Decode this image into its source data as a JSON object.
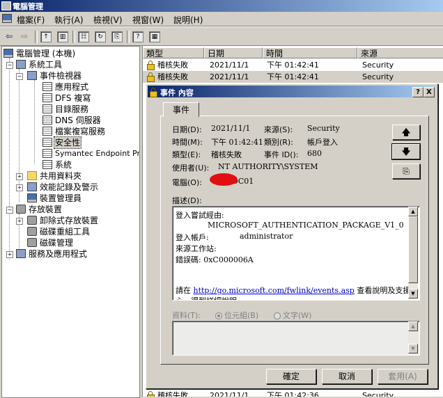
{
  "window": {
    "title": "電腦管理"
  },
  "menu": [
    {
      "label": "檔案(F)"
    },
    {
      "label": "執行(A)"
    },
    {
      "label": "檢視(V)"
    },
    {
      "label": "視窗(W)"
    },
    {
      "label": "說明(H)"
    }
  ],
  "tree": {
    "root": "電腦管理 (本機)",
    "system_tools": "系統工具",
    "event_viewer": "事件檢視器",
    "logs": [
      "應用程式",
      "DFS 複寫",
      "目錄服務",
      "DNS 伺服器",
      "檔案複寫服務",
      "安全性",
      "Symantec Endpoint Protection",
      "系統"
    ],
    "shared_folders": "共用資料夾",
    "perf_logs": "效能記錄及警示",
    "device_manager": "裝置管理員",
    "storage": "存放裝置",
    "removable": "卸除式存放裝置",
    "defrag": "磁碟重組工具",
    "disk_mgmt": "磁碟管理",
    "services": "服務及應用程式"
  },
  "list": {
    "columns": [
      "類型",
      "日期",
      "時間",
      "來源"
    ],
    "rows": [
      {
        "type": "稽核失敗",
        "date": "2021/11/1",
        "time": "下午 01:42:41",
        "source": "Security"
      },
      {
        "type": "稽核失敗",
        "date": "2021/11/1",
        "time": "下午 01:42:41",
        "source": "Security"
      }
    ],
    "bottom_row": {
      "type": "稽核失敗",
      "date": "2021/11/1",
      "time": "下午 01:42:36",
      "source": "Security"
    }
  },
  "dialog": {
    "title": "事件 內容",
    "tab": "事件",
    "labels": {
      "date": "日期(D):",
      "time": "時間(M):",
      "type": "類型(E):",
      "user": "使用者(U):",
      "computer": "電腦(O):",
      "source": "來源(S):",
      "category": "類別(R):",
      "event_id": "事件 ID():",
      "desc": "描述(D):",
      "data": "資料(T):",
      "bytes": "位元組(B)",
      "words": "文字(W)"
    },
    "values": {
      "date": "2021/11/1",
      "time": "下午 01:42:41",
      "type": "稽核失敗",
      "user": "NT AUTHORITY\\SYSTEM",
      "computer": "DC01",
      "source": "Security",
      "category": "帳戶登入",
      "event_id": "680"
    },
    "description": [
      "登入嘗試經由:",
      "MICROSOFT_AUTHENTICATION_PACKAGE_V1_0",
      "登入帳戶:",
      "administrator",
      "來源工作站:",
      "錯誤碼: 0xC000006A"
    ],
    "help_prefix": "請在 ",
    "help_link": "http://go.microsoft.com/fwlink/events.asp",
    "help_suffix": " 查看說明及支援中",
    "help_line2": "心，得到詳細說明",
    "buttons": {
      "ok": "確定",
      "cancel": "取消",
      "apply": "套用(A)"
    },
    "title_buttons": {
      "help": "?",
      "close": "X"
    }
  }
}
